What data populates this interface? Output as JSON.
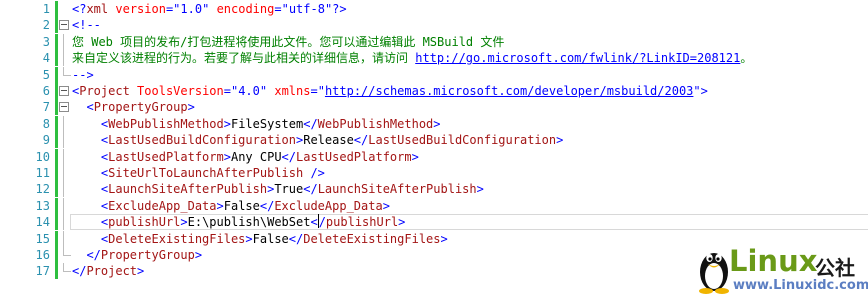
{
  "editor": {
    "current_line": 14,
    "lines": [
      {
        "n": "1",
        "fold": "none",
        "parts": [
          [
            "p",
            "<?"
          ],
          [
            "e",
            "xml"
          ],
          [
            "t",
            " "
          ],
          [
            "a",
            "version"
          ],
          [
            "p",
            "=\""
          ],
          [
            "v",
            "1.0"
          ],
          [
            "p",
            "\""
          ],
          [
            "t",
            " "
          ],
          [
            "a",
            "encoding"
          ],
          [
            "p",
            "=\""
          ],
          [
            "v",
            "utf-8"
          ],
          [
            "p",
            "\"?>"
          ]
        ]
      },
      {
        "n": "2",
        "fold": "box",
        "parts": [
          [
            "p",
            "<!--"
          ]
        ]
      },
      {
        "n": "3",
        "fold": "guide",
        "parts": [
          [
            "c",
            "您 Web 项目的发布/打包进程将使用此文件。您可以通过编辑此 MSBuild 文件"
          ]
        ]
      },
      {
        "n": "4",
        "fold": "guide",
        "parts": [
          [
            "c",
            "来自定义该进程的行为。若要了解与此相关的详细信息，请访问 "
          ],
          [
            "u",
            "http://go.microsoft.com/fwlink/?LinkID=208121"
          ],
          [
            "c",
            "。"
          ]
        ]
      },
      {
        "n": "5",
        "fold": "end",
        "parts": [
          [
            "p",
            "-->"
          ]
        ]
      },
      {
        "n": "6",
        "fold": "box",
        "parts": [
          [
            "p",
            "<"
          ],
          [
            "e",
            "Project"
          ],
          [
            "t",
            " "
          ],
          [
            "a",
            "ToolsVersion"
          ],
          [
            "p",
            "=\""
          ],
          [
            "v",
            "4.0"
          ],
          [
            "p",
            "\""
          ],
          [
            "t",
            " "
          ],
          [
            "a",
            "xmlns"
          ],
          [
            "p",
            "=\""
          ],
          [
            "u",
            "http://schemas.microsoft.com/developer/msbuild/2003"
          ],
          [
            "p",
            "\">"
          ]
        ]
      },
      {
        "n": "7",
        "fold": "box",
        "parts": [
          [
            "t",
            "  "
          ],
          [
            "p",
            "<"
          ],
          [
            "e",
            "PropertyGroup"
          ],
          [
            "p",
            ">"
          ]
        ]
      },
      {
        "n": "8",
        "fold": "guide",
        "parts": [
          [
            "t",
            "    "
          ],
          [
            "p",
            "<"
          ],
          [
            "e",
            "WebPublishMethod"
          ],
          [
            "p",
            ">"
          ],
          [
            "t",
            "FileSystem"
          ],
          [
            "p",
            "</"
          ],
          [
            "e",
            "WebPublishMethod"
          ],
          [
            "p",
            ">"
          ]
        ]
      },
      {
        "n": "9",
        "fold": "guide",
        "parts": [
          [
            "t",
            "    "
          ],
          [
            "p",
            "<"
          ],
          [
            "e",
            "LastUsedBuildConfiguration"
          ],
          [
            "p",
            ">"
          ],
          [
            "t",
            "Release"
          ],
          [
            "p",
            "</"
          ],
          [
            "e",
            "LastUsedBuildConfiguration"
          ],
          [
            "p",
            ">"
          ]
        ]
      },
      {
        "n": "10",
        "fold": "guide",
        "parts": [
          [
            "t",
            "    "
          ],
          [
            "p",
            "<"
          ],
          [
            "e",
            "LastUsedPlatform"
          ],
          [
            "p",
            ">"
          ],
          [
            "t",
            "Any CPU"
          ],
          [
            "p",
            "</"
          ],
          [
            "e",
            "LastUsedPlatform"
          ],
          [
            "p",
            ">"
          ]
        ]
      },
      {
        "n": "11",
        "fold": "guide",
        "parts": [
          [
            "t",
            "    "
          ],
          [
            "p",
            "<"
          ],
          [
            "e",
            "SiteUrlToLaunchAfterPublish"
          ],
          [
            "t",
            " "
          ],
          [
            "p",
            "/>"
          ]
        ]
      },
      {
        "n": "12",
        "fold": "guide",
        "parts": [
          [
            "t",
            "    "
          ],
          [
            "p",
            "<"
          ],
          [
            "e",
            "LaunchSiteAfterPublish"
          ],
          [
            "p",
            ">"
          ],
          [
            "t",
            "True"
          ],
          [
            "p",
            "</"
          ],
          [
            "e",
            "LaunchSiteAfterPublish"
          ],
          [
            "p",
            ">"
          ]
        ]
      },
      {
        "n": "13",
        "fold": "guide",
        "parts": [
          [
            "t",
            "    "
          ],
          [
            "p",
            "<"
          ],
          [
            "e",
            "ExcludeApp_Data"
          ],
          [
            "p",
            ">"
          ],
          [
            "t",
            "False"
          ],
          [
            "p",
            "</"
          ],
          [
            "e",
            "ExcludeApp_Data"
          ],
          [
            "p",
            ">"
          ]
        ]
      },
      {
        "n": "14",
        "fold": "guide",
        "parts": [
          [
            "t",
            "    "
          ],
          [
            "p",
            "<"
          ],
          [
            "e",
            "publishUrl"
          ],
          [
            "p",
            ">"
          ],
          [
            "t",
            "E:\\publish\\WebSet"
          ],
          [
            "p",
            "<"
          ],
          [
            "caret",
            ""
          ],
          [
            "p",
            "/"
          ],
          [
            "e",
            "publishUrl"
          ],
          [
            "p",
            ">"
          ]
        ]
      },
      {
        "n": "15",
        "fold": "guide",
        "parts": [
          [
            "t",
            "    "
          ],
          [
            "p",
            "<"
          ],
          [
            "e",
            "DeleteExistingFiles"
          ],
          [
            "p",
            ">"
          ],
          [
            "t",
            "False"
          ],
          [
            "p",
            "</"
          ],
          [
            "e",
            "DeleteExistingFiles"
          ],
          [
            "p",
            ">"
          ]
        ]
      },
      {
        "n": "16",
        "fold": "end",
        "parts": [
          [
            "t",
            "  "
          ],
          [
            "p",
            "</"
          ],
          [
            "e",
            "PropertyGroup"
          ],
          [
            "p",
            ">"
          ]
        ]
      },
      {
        "n": "17",
        "fold": "end",
        "parts": [
          [
            "p",
            "</"
          ],
          [
            "e",
            "Project"
          ],
          [
            "p",
            ">"
          ]
        ]
      }
    ]
  },
  "watermark": {
    "brand": "Linux",
    "brand_cn": "公社",
    "url": "www.Linuxidc.com"
  }
}
